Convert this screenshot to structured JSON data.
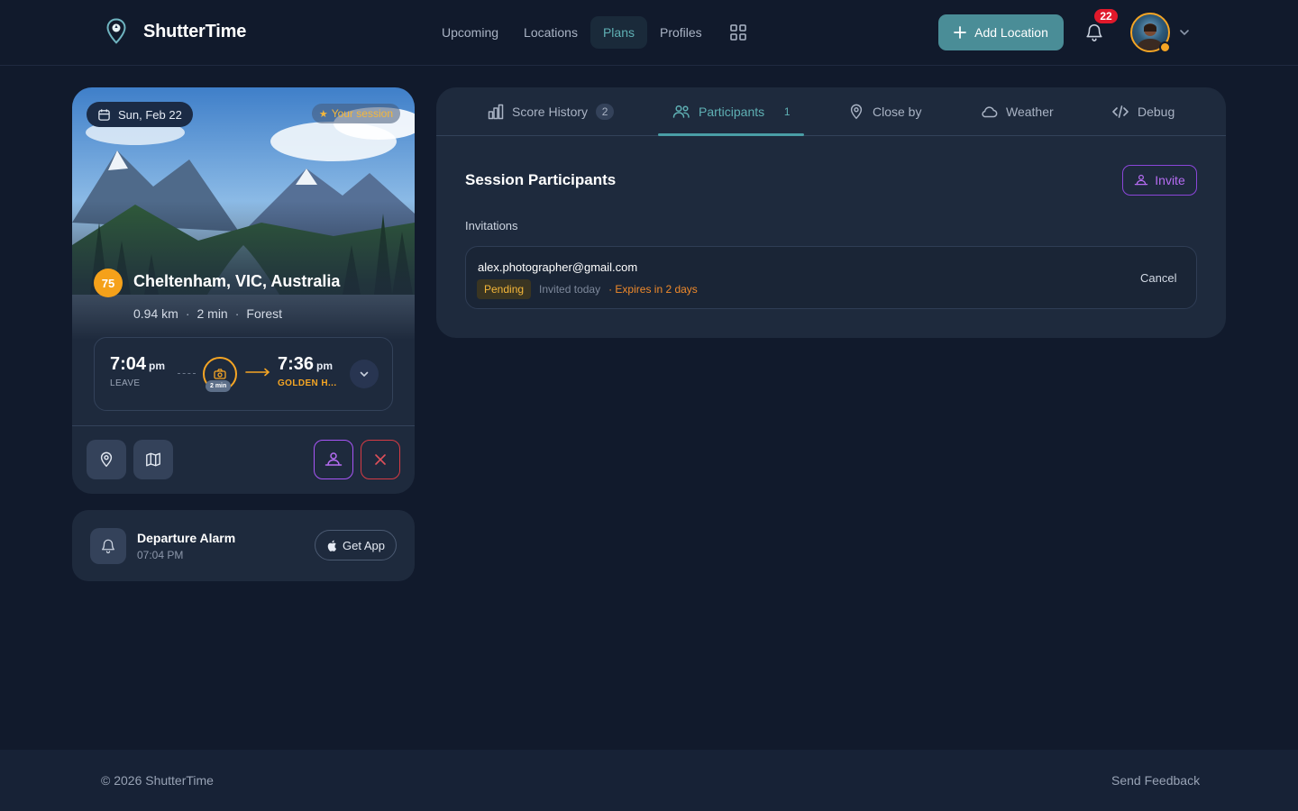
{
  "app": {
    "name": "ShutterTime"
  },
  "nav": {
    "items": [
      {
        "label": "Upcoming",
        "active": false
      },
      {
        "label": "Locations",
        "active": false
      },
      {
        "label": "Plans",
        "active": true
      },
      {
        "label": "Profiles",
        "active": false
      }
    ],
    "grid_icon": "grid-icon"
  },
  "header": {
    "add_location_label": "Add Location",
    "notification_count": "22"
  },
  "session": {
    "date": "Sun, Feb 22",
    "badge": "Your session",
    "score": "75",
    "location": "Cheltenham, VIC, Australia",
    "distance": "0.94 km",
    "duration": "2 min",
    "terrain": "Forest",
    "leave_time": "7:04",
    "leave_period": "pm",
    "leave_label": "LEAVE",
    "travel_tag": "2 min",
    "event_time": "7:36",
    "event_period": "pm",
    "event_label": "GOLDEN H..."
  },
  "alarm": {
    "title": "Departure Alarm",
    "time": "07:04 PM",
    "get_app_label": "Get App"
  },
  "tabs": [
    {
      "label": "Score History",
      "count": "2",
      "active": false
    },
    {
      "label": "Participants",
      "count": "1",
      "active": true
    },
    {
      "label": "Close by",
      "active": false
    },
    {
      "label": "Weather",
      "active": false
    },
    {
      "label": "Debug",
      "active": false
    }
  ],
  "participants": {
    "title": "Session Participants",
    "invite_label": "Invite",
    "invitations_label": "Invitations",
    "invitations": [
      {
        "email": "alex.photographer@gmail.com",
        "status": "Pending",
        "invited": "Invited today",
        "expires": "· Expires in 2 days",
        "cancel_label": "Cancel"
      }
    ]
  },
  "footer": {
    "copyright": "© 2026 ShutterTime",
    "feedback": "Send Feedback"
  },
  "colors": {
    "background": "#111a2c",
    "card": "#1e2a3d",
    "accent_teal": "#4a8d97",
    "accent_gold": "#f5a524",
    "accent_purple": "#a855f7",
    "danger": "#d63b44"
  }
}
